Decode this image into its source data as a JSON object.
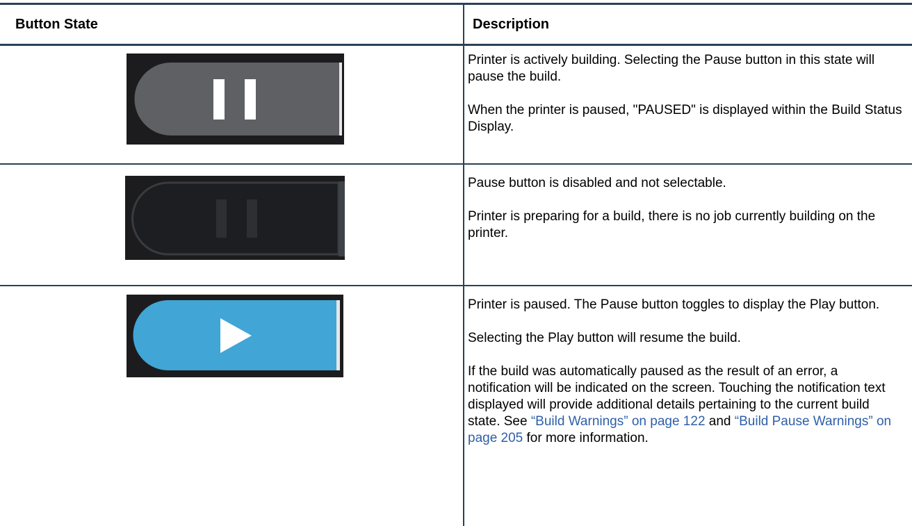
{
  "table": {
    "headers": {
      "state": "Button State",
      "description": "Description"
    },
    "rows": [
      {
        "image": "pause-button-active",
        "paragraphs": [
          "Printer is actively building. Selecting the Pause button in this state will pause the build.",
          "When the printer is paused, \"PAUSED\" is displayed within the Build Status Display."
        ]
      },
      {
        "image": "pause-button-disabled",
        "paragraphs": [
          "Pause button is disabled and not selectable.",
          "Printer is preparing for a build, there is no job currently building on the printer."
        ]
      },
      {
        "image": "play-button",
        "paragraphs": [
          "Printer is paused. The Pause button toggles to display the Play button.",
          "Selecting the Play button will resume the build."
        ],
        "note": {
          "before": "If the build was automatically paused as the result of an error, a notification will be indicated on the screen. Touching the notification text displayed will provide additional details pertaining to the current build state. See ",
          "link1": "“Build Warnings” on page 122",
          "between": " and ",
          "link2": "“Build Pause Warnings” on page 205",
          "after": " for more information."
        }
      }
    ]
  },
  "colors": {
    "rule": "#2b3f57",
    "link": "#2e5fa8",
    "pause_active": "#5f6064",
    "pause_disabled_outline": "#3a3b3f",
    "play": "#41a5d6",
    "image_background": "#1c1c1e"
  }
}
